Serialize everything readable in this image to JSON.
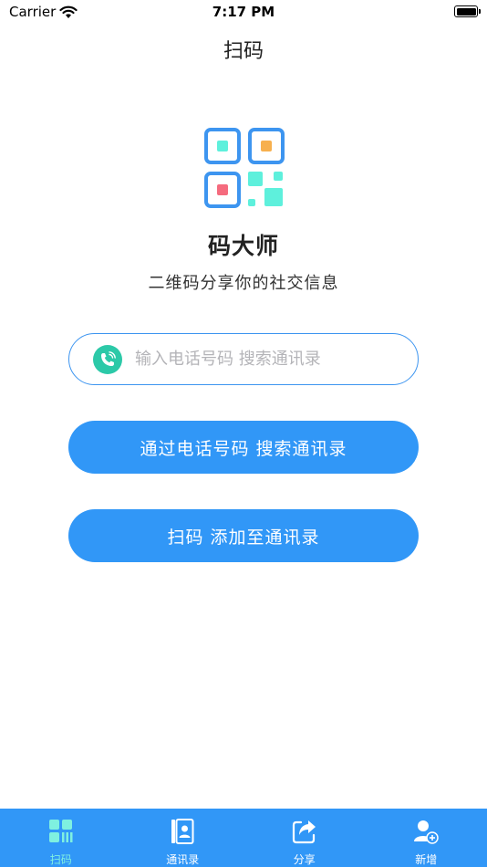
{
  "status_bar": {
    "carrier": "Carrier",
    "time": "7:17 PM"
  },
  "nav": {
    "title": "扫码"
  },
  "hero": {
    "app_name": "码大师",
    "subtitle": "二维码分享你的社交信息"
  },
  "search": {
    "placeholder": "输入电话号码 搜索通讯录",
    "value": "",
    "icon": "phone-icon"
  },
  "buttons": {
    "search_label": "通过电话号码 搜索通讯录",
    "scan_label": "扫码 添加至通讯录"
  },
  "tabs": [
    {
      "label": "扫码",
      "icon": "qr-scan-icon",
      "active": true
    },
    {
      "label": "通讯录",
      "icon": "contacts-book-icon",
      "active": false
    },
    {
      "label": "分享",
      "icon": "share-icon",
      "active": false
    },
    {
      "label": "新增",
      "icon": "add-user-icon",
      "active": false
    }
  ],
  "colors": {
    "accent": "#3197f7",
    "tab_active": "#7ff0e0",
    "phone_icon_bg": "#2cc9a8",
    "logo_blue": "#3d95f0",
    "logo_cyan": "#5ef0dc",
    "logo_orange": "#f7b04e",
    "logo_red": "#f56b7e"
  }
}
